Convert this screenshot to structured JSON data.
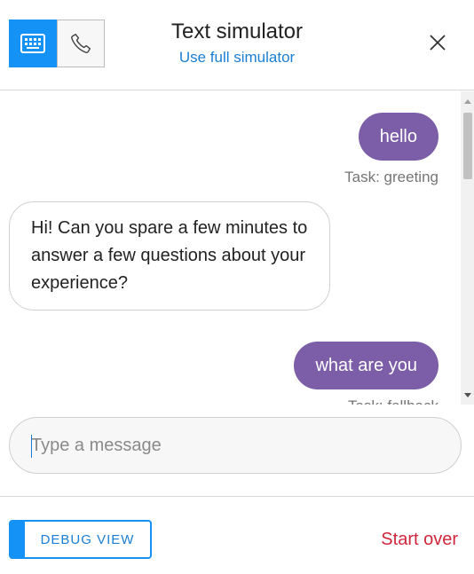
{
  "header": {
    "title": "Text simulator",
    "full_link": "Use full simulator",
    "modes": {
      "keyboard": "keyboard-icon",
      "phone": "phone-icon",
      "active": "keyboard"
    },
    "close_icon": "close-icon"
  },
  "transcript": {
    "messages": [
      {
        "from": "user",
        "text": "hello",
        "task": "Task: greeting"
      },
      {
        "from": "bot",
        "text": "Hi! Can you spare a few minutes to answer a few questions about your experience?"
      },
      {
        "from": "user",
        "text": "what are you",
        "task": "Task: fallback"
      }
    ]
  },
  "input": {
    "placeholder": "Type a message",
    "value": ""
  },
  "footer": {
    "debug_label": "DEBUG VIEW",
    "start_over": "Start over"
  },
  "colors": {
    "accent": "#1592f6",
    "user_bubble": "#7b5ea7",
    "start_over": "#d0263c",
    "link": "#1a7fd4"
  }
}
